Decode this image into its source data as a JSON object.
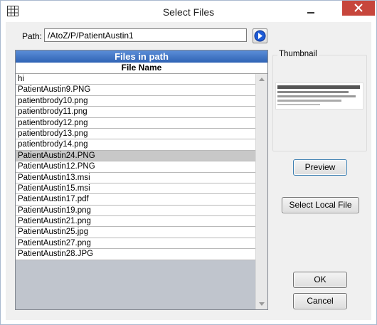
{
  "window": {
    "title": "Select Files"
  },
  "path": {
    "label": "Path:",
    "value": "/AtoZ/P/PatientAustin1"
  },
  "files": {
    "header": "Files in path",
    "column": "File Name",
    "items": [
      "hi",
      "PatientAustin9.PNG",
      "patientbrody10.png",
      "patientbrody11.png",
      "patientbrody12.png",
      "patientbrody13.png",
      "patientbrody14.png",
      "PatientAustin24.PNG",
      "PatientAustin12.PNG",
      "PatientAustin13.msi",
      "PatientAustin15.msi",
      "PatientAustin17.pdf",
      "PatientAustin19.png",
      "PatientAustin21.png",
      "PatientAustin25.jpg",
      "PatientAustin27.png",
      "PatientAustin28.JPG"
    ],
    "selected": "PatientAustin24.PNG"
  },
  "thumbnail": {
    "label": "Thumbnail"
  },
  "buttons": {
    "preview": "Preview",
    "select_local": "Select Local File",
    "ok": "OK",
    "cancel": "Cancel"
  },
  "colors": {
    "header_blue": "#3a6fc2",
    "close_red": "#c7463c",
    "selection_gray": "#c8c8c8"
  },
  "icons": [
    "app-grid-icon",
    "minimize-icon",
    "close-icon",
    "go-arrow-icon",
    "scroll-up-icon",
    "scroll-down-icon"
  ]
}
